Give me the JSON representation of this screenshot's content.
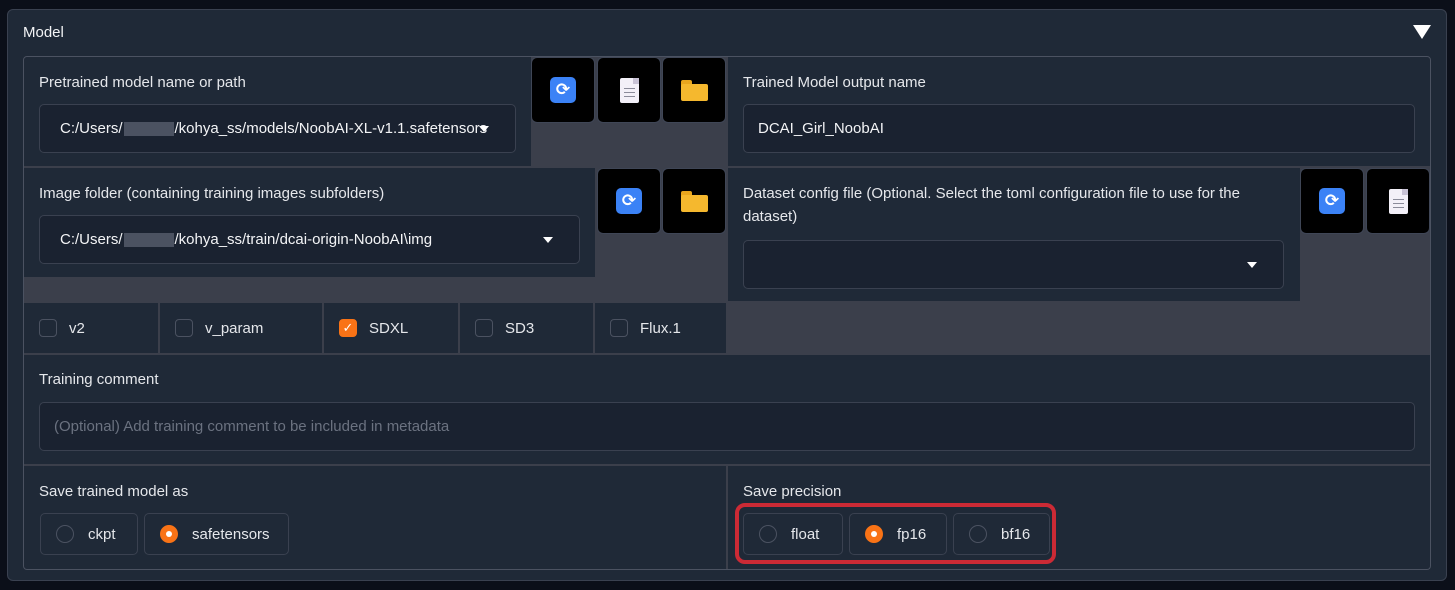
{
  "accordion": {
    "label": "Model",
    "toggle_icon": "triangle-down-icon"
  },
  "pretrained": {
    "label": "Pretrained model name or path",
    "value_prefix": "C:/Users/",
    "value_suffix": "/kohya_ss/models/NoobAI-XL-v1.1.safetensors"
  },
  "output_name": {
    "label": "Trained Model output name",
    "value": "DCAI_Girl_NoobAI"
  },
  "image_folder": {
    "label": "Image folder (containing training images subfolders)",
    "value_prefix": "C:/Users/",
    "value_suffix": "/kohya_ss/train/dcai-origin-NoobAI\\img"
  },
  "dataset_config": {
    "label": "Dataset config file (Optional. Select the toml configuration file to use for the dataset)",
    "value": ""
  },
  "model_flags": [
    {
      "label": "v2",
      "checked": false
    },
    {
      "label": "v_param",
      "checked": false
    },
    {
      "label": "SDXL",
      "checked": true
    },
    {
      "label": "SD3",
      "checked": false
    },
    {
      "label": "Flux.1",
      "checked": false
    }
  ],
  "training_comment": {
    "label": "Training comment",
    "placeholder": "(Optional) Add training comment to be included in metadata"
  },
  "save_model_as": {
    "label": "Save trained model as",
    "options": [
      "ckpt",
      "safetensors"
    ],
    "selected": "safetensors"
  },
  "save_precision": {
    "label": "Save precision",
    "options": [
      "float",
      "fp16",
      "bf16"
    ],
    "selected": "fp16"
  },
  "colors": {
    "accent": "#f97316",
    "highlight": "#cc2a35",
    "background": "#1f2937"
  }
}
